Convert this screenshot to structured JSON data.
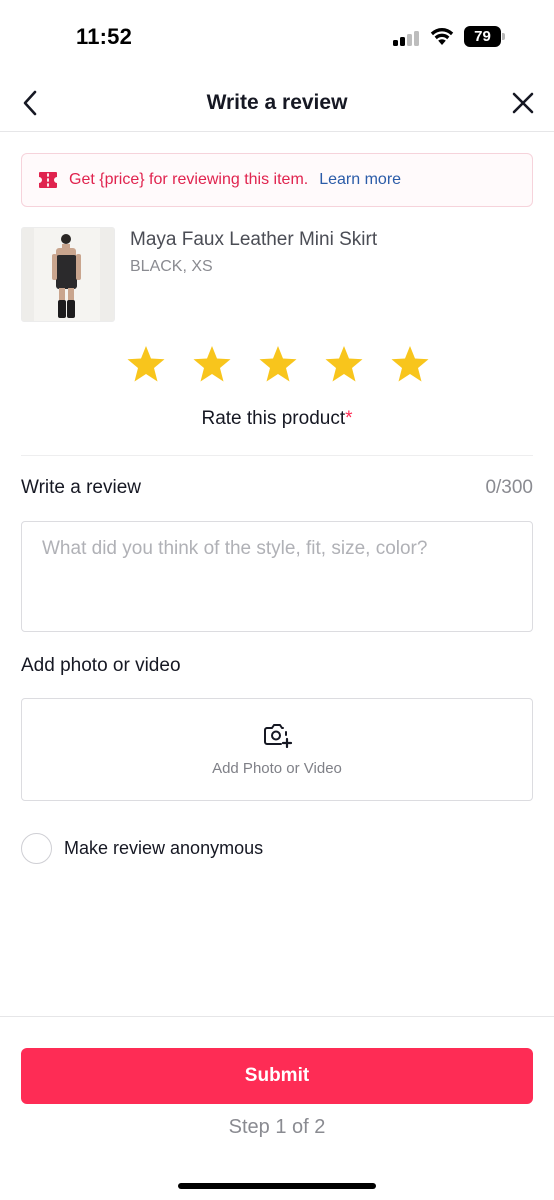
{
  "status_bar": {
    "time": "11:52",
    "battery": "79",
    "icons": [
      "cellular-signal-icon",
      "wifi-icon",
      "battery-icon"
    ]
  },
  "nav": {
    "title": "Write a review",
    "back_icon": "chevron-left-icon",
    "close_icon": "close-icon"
  },
  "promo": {
    "icon": "coupon-icon",
    "text": "Get {price} for reviewing this item.",
    "link": "Learn more"
  },
  "product": {
    "name": "Maya Faux Leather Mini Skirt",
    "variant": "BLACK, XS"
  },
  "rating": {
    "value": 5,
    "max": 5,
    "label": "Rate this product",
    "required_marker": "*"
  },
  "review": {
    "label": "Write a review",
    "counter": "0/300",
    "placeholder": "What did you think of the style, fit, size, color?",
    "value": ""
  },
  "media": {
    "label": "Add photo or video",
    "button_text": "Add Photo or Video",
    "icon": "camera-add-icon"
  },
  "anonymous": {
    "label": "Make review anonymous",
    "checked": false
  },
  "footer": {
    "submit": "Submit",
    "step": "Step 1 of 2"
  },
  "colors": {
    "accent": "#fe2c55",
    "star": "#f8c51c",
    "promo_text": "#e0234e",
    "link": "#2b5ca8"
  }
}
